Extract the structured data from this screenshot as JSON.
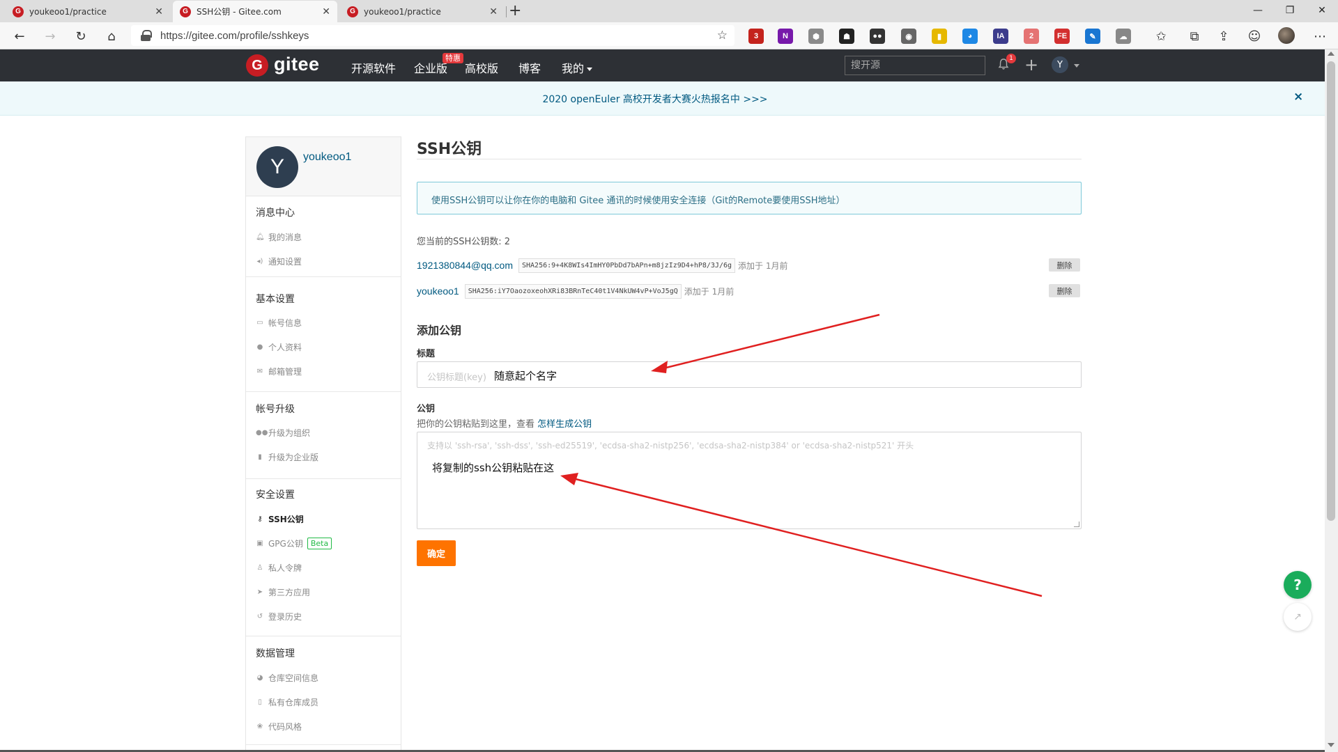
{
  "browser": {
    "tabs": [
      {
        "title": "youkeoo1/practice",
        "favicon": "G",
        "active": false
      },
      {
        "title": "SSH公钥 - Gitee.com",
        "favicon": "G",
        "active": true
      },
      {
        "title": "youkeoo1/practice",
        "favicon": "G",
        "active": false
      }
    ],
    "url": "https://gitee.com/profile/sshkeys",
    "extensions": [
      {
        "icon": "shield-badge-icon",
        "label": "3",
        "color": "#c4231d"
      },
      {
        "icon": "onenote-icon",
        "label": "N",
        "color": "#7719aa"
      },
      {
        "icon": "puzzle-icon",
        "label": "⬢",
        "color": "#8a8a8a"
      },
      {
        "icon": "robot-icon",
        "label": "☗",
        "color": "#222222"
      },
      {
        "icon": "glasses-icon",
        "label": "●●",
        "color": "#333333"
      },
      {
        "icon": "camera-icon",
        "label": "◉",
        "color": "#666666"
      },
      {
        "icon": "film-icon",
        "label": "▮",
        "color": "#e6b800"
      },
      {
        "icon": "globe-icon",
        "label": "◕",
        "color": "#1e88e5"
      },
      {
        "icon": "ia-icon",
        "label": "IA",
        "color": "#3c3c8c"
      },
      {
        "icon": "calendar-badge-icon",
        "label": "2",
        "color": "#e57373"
      },
      {
        "icon": "fe-icon",
        "label": "FE",
        "color": "#d32f2f"
      },
      {
        "icon": "eyedropper-icon",
        "label": "✎",
        "color": "#1976d2"
      },
      {
        "icon": "cloud-sync-icon",
        "label": "☁",
        "color": "#888888"
      }
    ]
  },
  "header": {
    "logo_text": "gitee",
    "nav": [
      "开源软件",
      "企业版",
      "高校版",
      "博客",
      "我的"
    ],
    "enterprise_badge": "特惠",
    "search_placeholder": "搜开源",
    "notif_count": "1",
    "user_initial": "Y"
  },
  "banner": {
    "text": "2020 openEuler 高校开发者大赛火热报名中 >>>",
    "close": "×"
  },
  "sidebar": {
    "user_initial": "Y",
    "username": "youkeoo1",
    "sections": [
      {
        "title": "消息中心",
        "items": [
          {
            "label": "我的消息",
            "icon": "bell-icon"
          },
          {
            "label": "通知设置",
            "icon": "speaker-icon"
          }
        ]
      },
      {
        "title": "基本设置",
        "items": [
          {
            "label": "帐号信息",
            "icon": "id-card-icon"
          },
          {
            "label": "个人资料",
            "icon": "user-icon"
          },
          {
            "label": "邮箱管理",
            "icon": "mail-icon"
          }
        ]
      },
      {
        "title": "帐号升级",
        "items": [
          {
            "label": "升级为组织",
            "icon": "users-icon"
          },
          {
            "label": "升级为企业版",
            "icon": "building-icon"
          }
        ]
      },
      {
        "title": "安全设置",
        "items": [
          {
            "label": "SSH公钥",
            "icon": "key-icon",
            "active": true
          },
          {
            "label": "GPG公钥",
            "icon": "lock-icon",
            "badge": "Beta"
          },
          {
            "label": "私人令牌",
            "icon": "token-icon"
          },
          {
            "label": "第三方应用",
            "icon": "rocket-icon"
          },
          {
            "label": "登录历史",
            "icon": "history-icon"
          }
        ]
      },
      {
        "title": "数据管理",
        "items": [
          {
            "label": "仓库空间信息",
            "icon": "pie-icon"
          },
          {
            "label": "私有仓库成员",
            "icon": "member-icon"
          },
          {
            "label": "代码风格",
            "icon": "palette-icon"
          }
        ]
      }
    ]
  },
  "main": {
    "title": "SSH公钥",
    "info": "使用SSH公钥可以让你在你的电脑和 Gitee 通讯的时候使用安全连接（Git的Remote要使用SSH地址）",
    "key_count_text": "您当前的SSH公钥数: 2",
    "keys": [
      {
        "title": "1921380844@qq.com",
        "fingerprint": "SHA256:9+4K8WIs4ImHY0PbDd7bAPn+m8jzIz9D4+hP8/3J/6g",
        "added": "添加于 1月前",
        "delete": "删除"
      },
      {
        "title": "youkeoo1",
        "fingerprint": "SHA256:iY7OaozoxeohXRi83BRnTeC40t1V4NkUW4vP+VoJ5gQ",
        "added": "添加于 1月前",
        "delete": "删除"
      }
    ],
    "add_heading": "添加公钥",
    "title_label": "标题",
    "title_placeholder": "公钥标题(key)",
    "title_annotation": "随意起个名字",
    "key_label": "公钥",
    "helper_text": "把你的公钥粘贴到这里，查看 ",
    "helper_link": "怎样生成公钥",
    "key_placeholder": "支持以 'ssh-rsa', 'ssh-dss', 'ssh-ed25519', 'ecdsa-sha2-nistp256', 'ecdsa-sha2-nistp384' or 'ecdsa-sha2-nistp521' 开头",
    "key_annotation": "将复制的ssh公钥粘贴在这",
    "submit": "确定"
  },
  "floating": {
    "help": "?",
    "share": "↗"
  },
  "colors": {
    "accent": "#fe7300",
    "header_bg": "#2d3035",
    "link": "#005980",
    "help_green": "#1aac5b",
    "annotation_arrow": "#e02020"
  }
}
